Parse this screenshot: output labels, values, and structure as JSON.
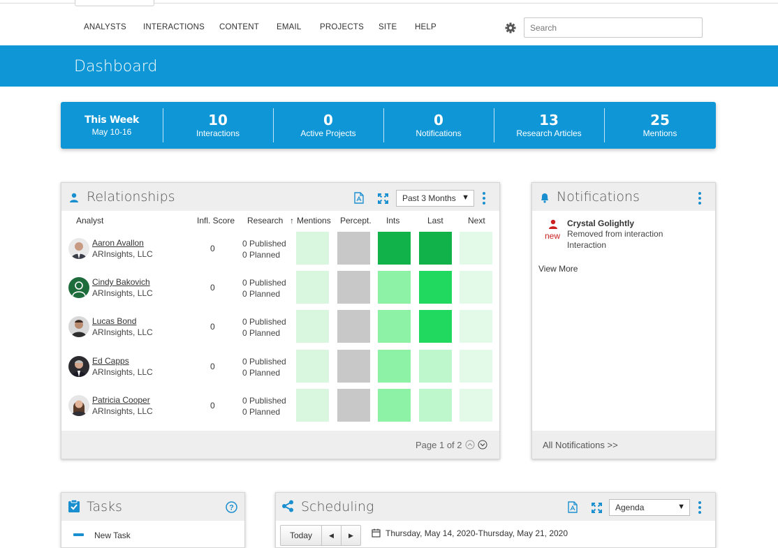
{
  "nav": {
    "items": [
      "ANALYSTS",
      "INTERACTIONS",
      "CONTENT",
      "EMAIL",
      "PROJECTS",
      "SITE",
      "HELP"
    ],
    "search_placeholder": "Search"
  },
  "banner": {
    "title": "Dashboard"
  },
  "stats": {
    "week_title": "This Week",
    "week_range": "May 10-16",
    "items": [
      {
        "value": "10",
        "label": "Interactions"
      },
      {
        "value": "0",
        "label": "Active Projects"
      },
      {
        "value": "0",
        "label": "Notifications"
      },
      {
        "value": "13",
        "label": "Research Articles"
      },
      {
        "value": "25",
        "label": "Mentions"
      }
    ]
  },
  "relationships": {
    "title": "Relationships",
    "range_select": "Past 3 Months",
    "columns": [
      "Analyst",
      "Infl. Score",
      "Research",
      "Mentions",
      "Percept.",
      "Ints",
      "Last",
      "Next"
    ],
    "sort_arrow": "↑",
    "rows": [
      {
        "name": "Aaron Avallon",
        "org": "ARInsights, LLC",
        "score": "0",
        "published": "0 Published",
        "planned": "0 Planned",
        "cells": [
          "#d9f7df",
          "#c8c8c8",
          "#11b249",
          "#11b249",
          "#e4fae8"
        ]
      },
      {
        "name": "Cindy Bakovich",
        "org": "ARInsights, LLC",
        "score": "0",
        "published": "0 Published",
        "planned": "0 Planned",
        "cells": [
          "#d9f7df",
          "#c8c8c8",
          "#8df2a6",
          "#22d95f",
          "#e4fae8"
        ]
      },
      {
        "name": "Lucas Bond",
        "org": "ARInsights, LLC",
        "score": "0",
        "published": "0 Published",
        "planned": "0 Planned",
        "cells": [
          "#d9f7df",
          "#c8c8c8",
          "#8df2a6",
          "#22d95f",
          "#e4fae8"
        ]
      },
      {
        "name": "Ed Capps",
        "org": "ARInsights, LLC",
        "score": "0",
        "published": "0 Published",
        "planned": "0 Planned",
        "cells": [
          "#d9f7df",
          "#c8c8c8",
          "#8df2a6",
          "#bdf7cb",
          "#e4fae8"
        ]
      },
      {
        "name": "Patricia Cooper",
        "org": "ARInsights, LLC",
        "score": "0",
        "published": "0 Published",
        "planned": "0 Planned",
        "cells": [
          "#d9f7df",
          "#c8c8c8",
          "#8df2a6",
          "#bdf7cb",
          "#e4fae8"
        ]
      }
    ],
    "pager": "Page 1 of 2"
  },
  "notifications": {
    "title": "Notifications",
    "item": {
      "name": "Crystal Golightly",
      "new_tag": "new",
      "line1": "Removed from interaction",
      "line2": "Interaction"
    },
    "view_more": "View More",
    "footer": "All Notifications >>"
  },
  "tasks": {
    "title": "Tasks",
    "first_item": "New Task"
  },
  "scheduling": {
    "title": "Scheduling",
    "view_select": "Agenda",
    "today_button": "Today",
    "date_range": "Thursday, May 14, 2020-Thursday, May 21, 2020"
  },
  "colors": {
    "brand": "#0e96d6",
    "accent_icon": "#1a8fd0",
    "alert_red": "#cc1f1f"
  }
}
